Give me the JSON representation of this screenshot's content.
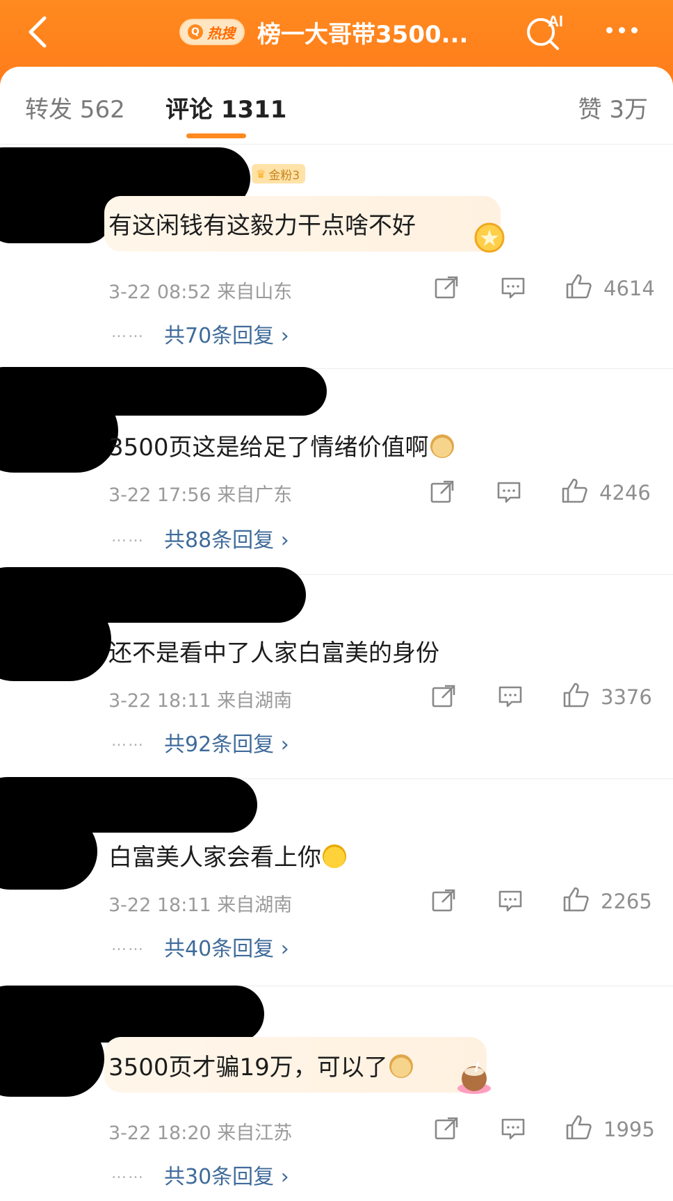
{
  "header": {
    "hot_label": "热搜",
    "title": "榜一大哥带3500..."
  },
  "tabs": [
    {
      "label": "转发 562"
    },
    {
      "label": "评论 1311"
    },
    {
      "label": "赞 3万"
    }
  ],
  "comments": [
    {
      "text": "有这闲钱有这毅力干点啥不好",
      "badge": "金粉3",
      "meta": "3-22 08:52  来自山东",
      "likes": "4614",
      "replies": "共70条回复 ›"
    },
    {
      "text": "3500页这是给足了情绪价值啊",
      "meta": "3-22 17:56  来自广东",
      "likes": "4246",
      "replies": "共88条回复 ›"
    },
    {
      "text": "还不是看中了人家白富美的身份",
      "meta": "3-22 18:11  来自湖南",
      "likes": "3376",
      "replies": "共92条回复 ›"
    },
    {
      "text": "白富美人家会看上你",
      "meta": "3-22 18:11  来自湖南",
      "likes": "2265",
      "replies": "共40条回复 ›"
    },
    {
      "text": "3500页才骗19万，可以了",
      "meta": "3-22 18:20  来自江苏",
      "likes": "1995",
      "replies": "共30条回复 ›"
    }
  ],
  "misc": {
    "dots": "……"
  },
  "colors": {
    "header_orange": "#ff7a1a",
    "reply_link": "#3f6b9a",
    "tab_indicator": "#ff8a1f"
  }
}
